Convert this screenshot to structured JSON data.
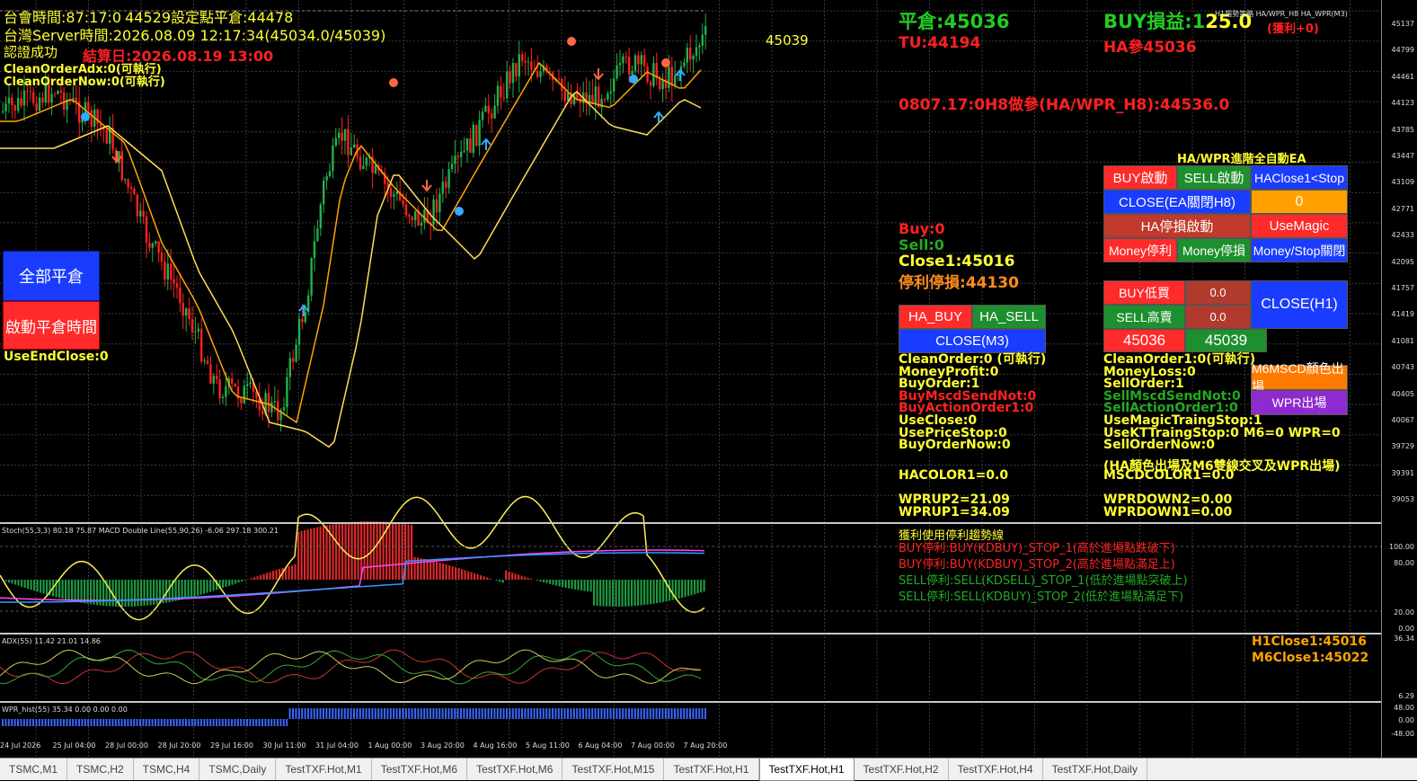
{
  "header": {
    "line1_prefix": "台會時間:",
    "line1_time": "87:17:0",
    "line1_mid": "452",
    "line1_overlap": "44529設定點平倉:44478",
    "line2": "台灣Server時間:2026.08.09 12:17:34(45034.0/45039)",
    "line3": "認證成功",
    "settle_date": "結算日:2026.08.19 13:00",
    "clean_adx": "CleanOrderAdx:0(可執行)",
    "clean_now": "CleanOrderNow:0(可執行)",
    "price_marker": "45039"
  },
  "left_panel": {
    "close_all_label": "全部平倉",
    "start_close_time_label": "啟動平倉時間",
    "use_end_close": "UseEndClose:0"
  },
  "right_top": {
    "flat": "平倉:45036",
    "tu": "TU:44194",
    "buy_profit": "BUY損益:1",
    "buy_profit_overlay": "25.0",
    "profit_note": "(獲利+0)",
    "ha_ref": "HA參45036",
    "h8_line": "0807.17:0H8做參(HA/WPR_H8):44536.0",
    "chart_title": "H1趨勢策略 HA/WPR_H8 HA_WPR(M3)"
  },
  "ea": {
    "title": "HA/WPR進階全自動EA",
    "buttons": {
      "buy_start": "BUY啟動",
      "sell_start": "SELL啟動",
      "ha_close": "HAClose1<Stop",
      "close_ea": "CLOSE(EA關閉H8)",
      "zero": "0",
      "ha_stop": "HA停損啟動",
      "use_magic": "UseMagic",
      "money_profit": "Money停利",
      "money_stop": "Money停損",
      "money_stop_close": "Money/Stop關閉",
      "buy_low": "BUY低買",
      "buy_low_val": "0.0",
      "sell_high": "SELL高賣",
      "sell_high_val": "0.0",
      "close_h1": "CLOSE(H1)",
      "bid": "45036",
      "ask": "45039",
      "msc_exit": "M6MSCD顏色出場",
      "wpr_exit": "WPR出場",
      "ha_buy": "HA_BUY",
      "ha_sell": "HA_SELL",
      "close_m3": "CLOSE(M3)"
    }
  },
  "status_mid": {
    "buy": "Buy:0",
    "sell": "Sell:0",
    "close1": "Close1:45016",
    "stop": "停利停損:44130"
  },
  "status_left_col": [
    {
      "text": "CleanOrder:0 (可執行)",
      "color": "#ffff33"
    },
    {
      "text": "MoneyProfit:0",
      "color": "#ffff33"
    },
    {
      "text": "BuyOrder:1",
      "color": "#ffff33"
    },
    {
      "text": "BuyMscdSendNot:0",
      "color": "#ff2222"
    },
    {
      "text": "BuyActionOrder1:0",
      "color": "#ff2222"
    },
    {
      "text": "UseClose:0",
      "color": "#ffff33"
    },
    {
      "text": "UsePriceStop:0",
      "color": "#ffff33"
    },
    {
      "text": "BuyOrderNow:0",
      "color": "#ffff33"
    }
  ],
  "status_right_col": [
    {
      "text": "CleanOrder1:0(可執行)",
      "color": "#ffff33"
    },
    {
      "text": "MoneyLoss:0",
      "color": "#ffff33"
    },
    {
      "text": "SellOrder:1",
      "color": "#ffff33"
    },
    {
      "text": "SellMscdSendNot:0",
      "color": "#22aa22"
    },
    {
      "text": "SellActionOrder1:0",
      "color": "#22aa22"
    },
    {
      "text": "UseMagicTraingStop:1",
      "color": "#ffff33"
    },
    {
      "text": "UseKTTraingStop:0  M6=0  WPR=0",
      "color": "#ffff33"
    },
    {
      "text": "SellOrderNow:0",
      "color": "#ffff33"
    }
  ],
  "indicators_text": {
    "ha_note": "(HA顏色出場及M6雙線交叉及WPR出場)",
    "hacolor": "HACOLOR1=0.0",
    "mscd": "MSCDCOLOR1=0.0",
    "wprup2": "WPRUP2=21.09",
    "wprup1": "WPRUP1=34.09",
    "wprdown2": "WPRDOWN2=0.00",
    "wprdown1": "WPRDOWN1=0.00",
    "trend_title": "獲利使用停利趨勢線",
    "trend_lines": [
      {
        "text": "BUY停利:BUY(KDBUY)_STOP_1(高於進場點跌破下)",
        "color": "#ff2222"
      },
      {
        "text": "BUY停利:BUY(KDBUY)_STOP_2(高於進場點滿足上)",
        "color": "#ff2222"
      },
      {
        "text": "SELL停利:SELL(KDSELL)_STOP_1(低於進場點突破上)",
        "color": "#22aa22"
      },
      {
        "text": "SELL停利:SELL(KDBUY)_STOP_2(低於進場點滿足下)",
        "color": "#22aa22"
      }
    ],
    "h1close": "H1Close1:45016",
    "m6close": "M6Close1:45022"
  },
  "subwindows": {
    "stoch_title": "Stoch(55,3,3) 80.18 75.87 MACD Double Line(55,90,26) -6.06 297.18 300.21",
    "adx_title": "ADX(55) 11.42 21.01 14.86",
    "wpr_title": "WPR_hist(55) 35.34 0.00 0.00 0.00"
  },
  "price_scale": [
    "45137",
    "44799",
    "44461",
    "44123",
    "43785",
    "43447",
    "43109",
    "42771",
    "42433",
    "42095",
    "41757",
    "41419",
    "41081",
    "40743",
    "40405",
    "40067",
    "39729",
    "39391",
    "39053"
  ],
  "stoch_scale": [
    "100.00",
    "80.00",
    "20.00",
    "0.00"
  ],
  "adx_scale": [
    "36.34",
    "6.29"
  ],
  "wpr_scale": [
    "48.00",
    "0.00",
    "-48.00"
  ],
  "time_labels": [
    "24 Jul 2026",
    "25 Jul 04:00",
    "28 Jul 00:00",
    "28 Jul 20:00",
    "29 Jul 16:00",
    "30 Jul 11:00",
    "31 Jul 04:00",
    "1 Aug 00:00",
    "3 Aug 20:00",
    "4 Aug 16:00",
    "5 Aug 11:00",
    "6 Aug 04:00",
    "7 Aug 00:00",
    "7 Aug 20:00"
  ],
  "tabs": [
    "TSMC,M1",
    "TSMC,H2",
    "TSMC,H4",
    "TSMC,Daily",
    "TestTXF.Hot,M1",
    "TestTXF.Hot,M6",
    "TestTXF.Hot,M6",
    "TestTXF.Hot,M15",
    "TestTXF.Hot,H1",
    "TestTXF.Hot,H1",
    "TestTXF.Hot,H2",
    "TestTXF.Hot,H4",
    "TestTXF.Hot,Daily"
  ],
  "active_tab_index": 9,
  "colors": {
    "up_candle": "#22b14c",
    "down_candle": "#ff2020",
    "ma_fast": "#ffa500",
    "ma_slow": "#ffdd55",
    "grid": "#3a3a3a"
  }
}
